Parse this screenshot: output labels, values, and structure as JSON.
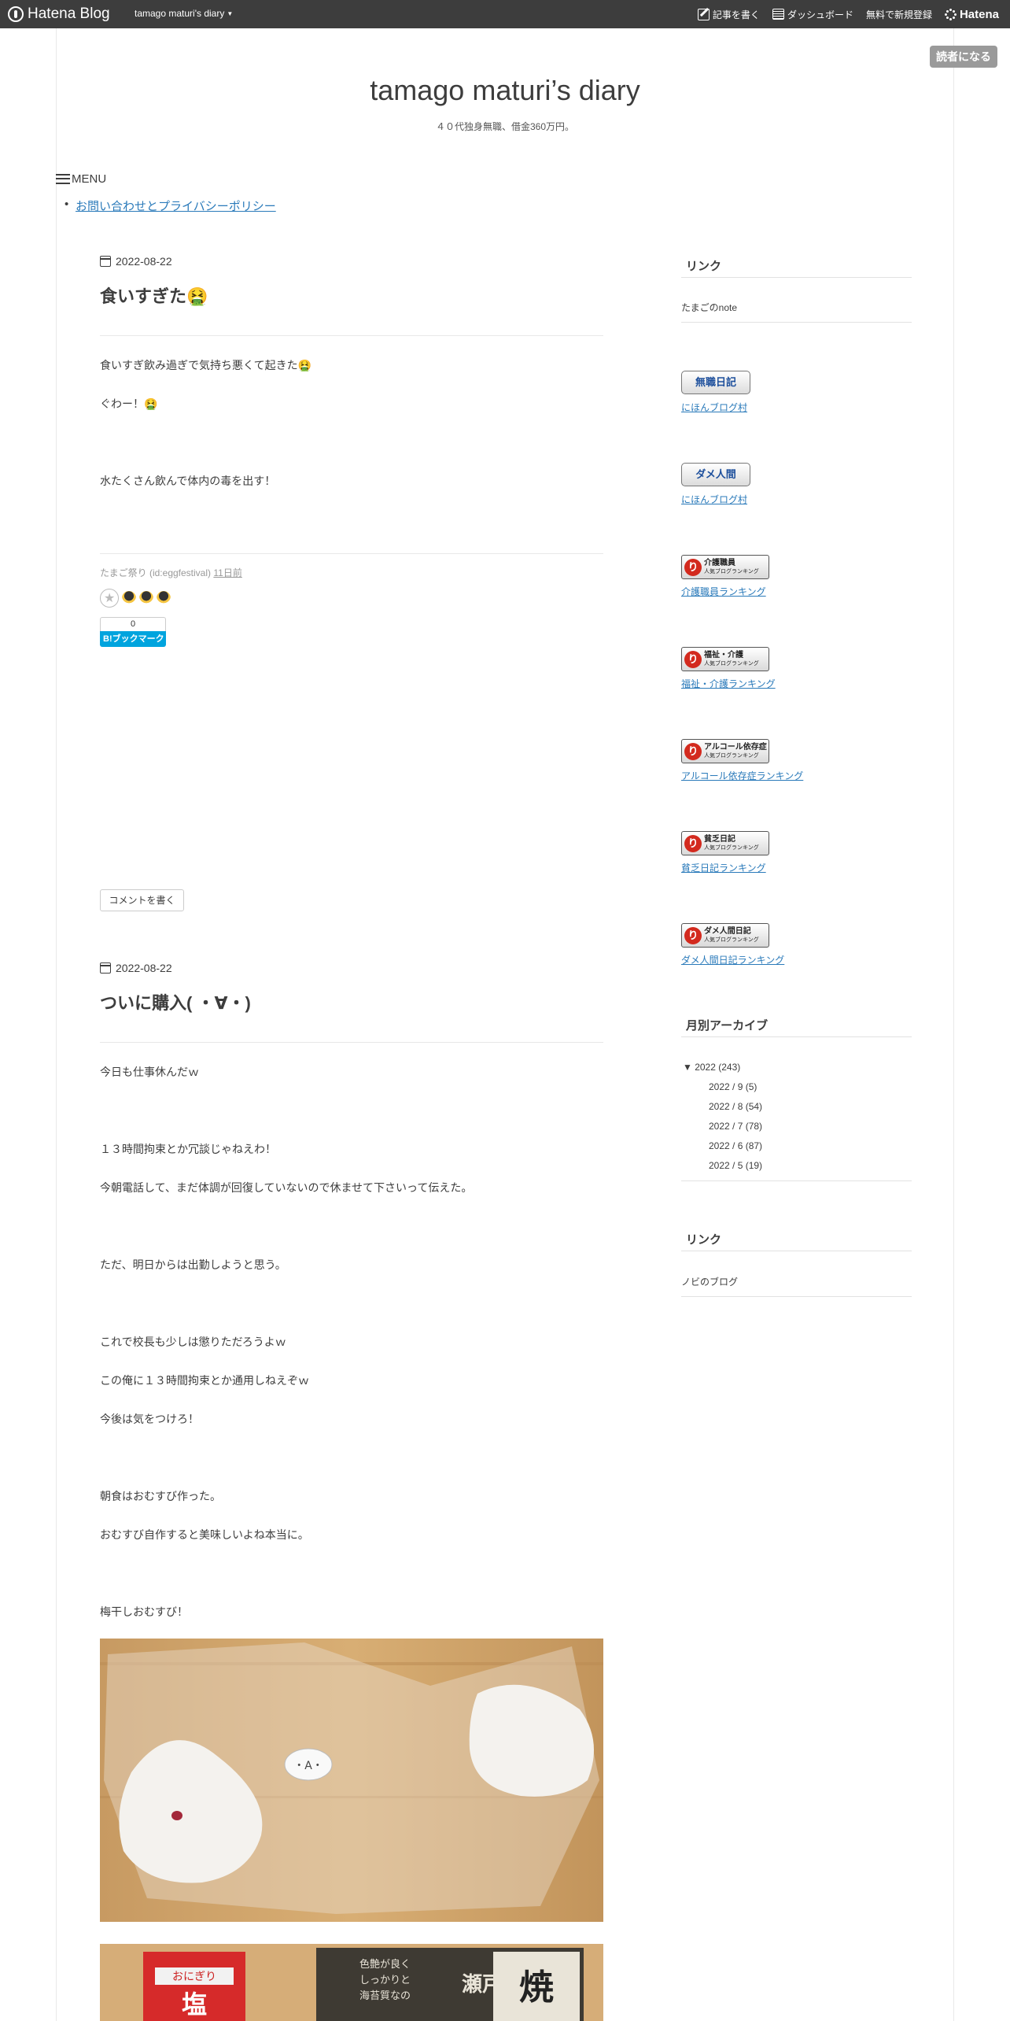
{
  "topbar": {
    "logo": "Hatena Blog",
    "blog_switch": "tamago maturi's diary",
    "write": "記事を書く",
    "dashboard": "ダッシュボード",
    "signup": "無料で新規登録",
    "hatena": "Hatena"
  },
  "reader_button": "読者になる",
  "header": {
    "title": "tamago maturi’s diary",
    "description": "４０代独身無職、借金360万円。"
  },
  "menu": {
    "label": "MENU",
    "items": [
      "お問い合わせとプライバシーポリシー"
    ]
  },
  "entries": [
    {
      "date": "2022-08-22",
      "title": "食いすぎた🤮",
      "paragraphs": [
        "食いすぎ飲み過ぎで気持ち悪くて起きた🤮",
        "ぐわー！🤮",
        "水たくさん飲んで体内の毒を出す！"
      ],
      "author": "たまご祭り (id:eggfestival)",
      "time_ago": "11日前",
      "bookmark_count": "0",
      "bookmark_label": "B!ブックマーク",
      "comment_button": "コメントを書く"
    },
    {
      "date": "2022-08-22",
      "title": "ついに購入( ・∀・)",
      "paragraphs": [
        "今日も仕事休んだｗ",
        "１３時間拘束とか冗談じゃねえわ！",
        "今朝電話して、まだ体調が回復していないので休ませて下さいって伝えた。",
        "ただ、明日からは出勤しようと思う。",
        "これで校長も少しは懲りただろうよｗ",
        "この俺に１３時間拘束とか通用しねえぞｗ",
        "今後は気をつけろ！",
        "朝食はおむすび作った。",
        "おむすび自作すると美味しいよね本当に。",
        "梅干しおむすび！"
      ]
    }
  ],
  "sidebar": {
    "links1": {
      "title": "リンク",
      "item": "たまごのnote"
    },
    "banners": [
      {
        "banner": "無職日記",
        "link": "にほんブログ村"
      },
      {
        "banner": "ダメ人間",
        "link": "にほんブログ村"
      },
      {
        "banner": "介護職員",
        "link": "介護職員ランキング"
      },
      {
        "banner": "福祉・介護",
        "link": "福祉・介護ランキング"
      },
      {
        "banner": "アルコール依存症",
        "link": "アルコール依存症ランキング"
      },
      {
        "banner": "貧乏日記",
        "link": "貧乏日記ランキング"
      },
      {
        "banner": "ダメ人間日記",
        "link": "ダメ人間日記ランキング"
      }
    ],
    "banner_sub": "人気ブログランキング",
    "archive": {
      "title": "月別アーカイブ",
      "year": "▼ 2022 (243)",
      "months": [
        "2022 / 9 (5)",
        "2022 / 8 (54)",
        "2022 / 7 (78)",
        "2022 / 6 (87)",
        "2022 / 5 (19)"
      ]
    },
    "links2": {
      "title": "リンク",
      "item": "ノビのブログ"
    }
  },
  "photo_labels": {
    "omusubi_face": "・A・",
    "package_left": "おにぎり",
    "package_left2": "塩",
    "package_right1": "色艶が良く",
    "package_right2": "しっかりと",
    "package_right3": "海苔質なの",
    "package_right4": "瀬戸",
    "package_right5": "焼"
  }
}
